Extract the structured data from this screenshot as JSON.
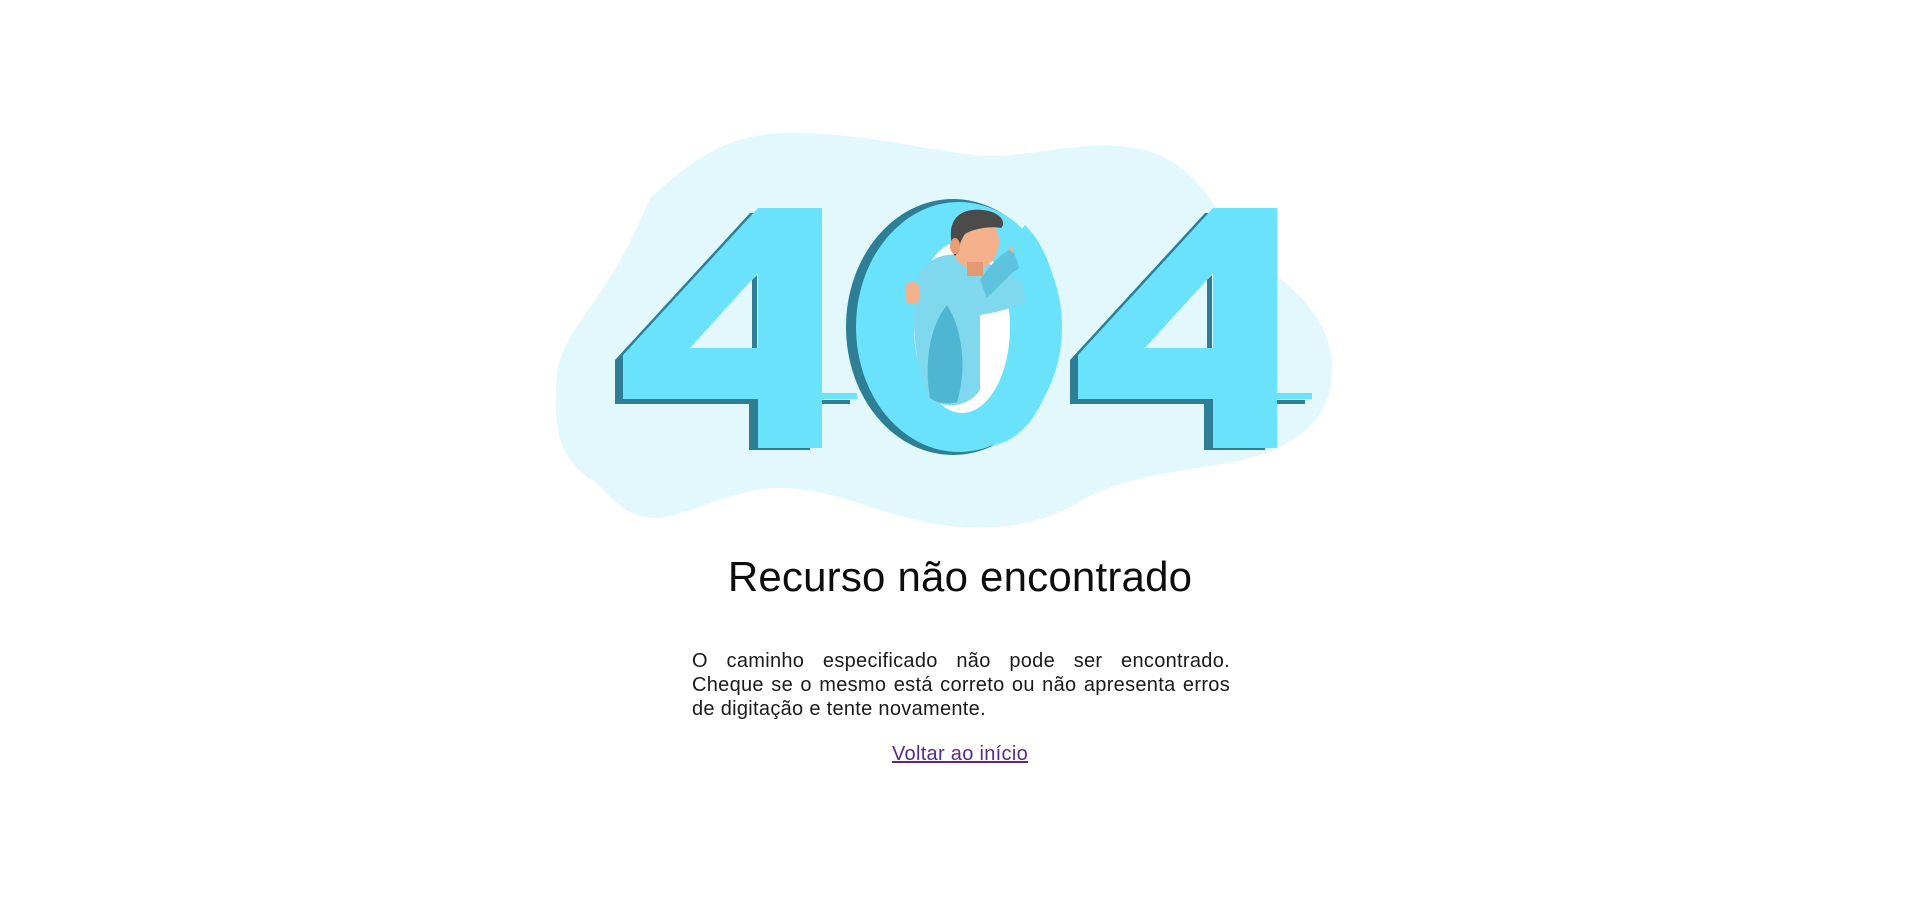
{
  "illustration": {
    "code_text": "404",
    "icon": "person-peeking-404-illustration",
    "colors": {
      "blob": "#e3f8fd",
      "digit_face": "#6ae2fc",
      "digit_shadow": "#2e7f96",
      "skin": "#f3b08a",
      "hair": "#4b4b4b"
    }
  },
  "heading": "Recurso não encontrado",
  "description": "O caminho especificado não pode ser encontrado. Cheque se o mesmo está correto ou não apresenta erros de digitação e tente novamente.",
  "home_link": {
    "label": "Voltar ao início"
  }
}
